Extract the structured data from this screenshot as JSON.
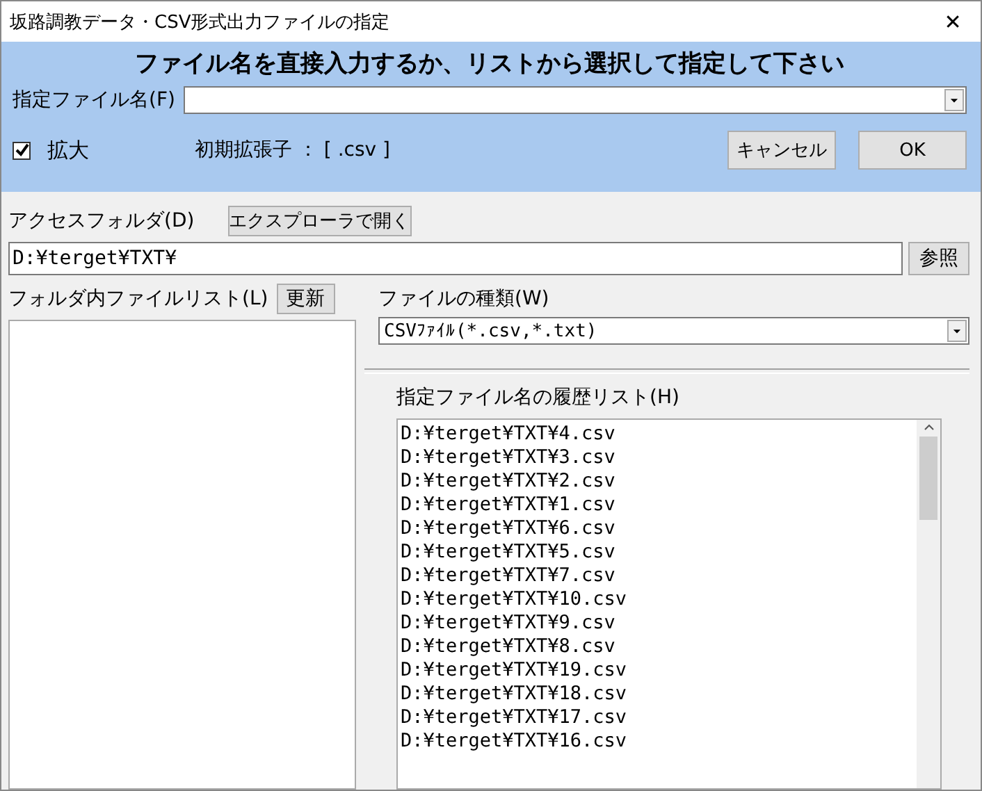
{
  "window": {
    "title": "坂路調教データ・CSV形式出力ファイルの指定",
    "close": "✕"
  },
  "header": {
    "instruction": "ファイル名を直接入力するか、リストから選択して指定して下さい",
    "file_label": "指定ファイル名(F)",
    "zoom": {
      "label": "拡大",
      "checked": true
    },
    "ext_label": "初期拡張子 ： [ .csv ]",
    "buttons": [
      "キャンセル",
      "OK"
    ]
  },
  "folder": {
    "label": "アクセスフォルダ(D)",
    "explorer_button": "エクスプローラで開く",
    "path": "D:¥terget¥TXT¥",
    "browse_button": "参照"
  },
  "file_list": {
    "label": "フォルダ内ファイルリスト(L)",
    "refresh_button": "更新"
  },
  "file_type": {
    "label": "ファイルの種類(W)",
    "value": "CSVﾌｧｲﾙ(*.csv,*.txt)"
  },
  "history": {
    "label": "指定ファイル名の履歴リスト(H)",
    "items": [
      "D:¥terget¥TXT¥4.csv",
      "D:¥terget¥TXT¥3.csv",
      "D:¥terget¥TXT¥2.csv",
      "D:¥terget¥TXT¥1.csv",
      "D:¥terget¥TXT¥6.csv",
      "D:¥terget¥TXT¥5.csv",
      "D:¥terget¥TXT¥7.csv",
      "D:¥terget¥TXT¥10.csv",
      "D:¥terget¥TXT¥9.csv",
      "D:¥terget¥TXT¥8.csv",
      "D:¥terget¥TXT¥19.csv",
      "D:¥terget¥TXT¥18.csv",
      "D:¥terget¥TXT¥17.csv",
      "D:¥terget¥TXT¥16.csv"
    ]
  }
}
